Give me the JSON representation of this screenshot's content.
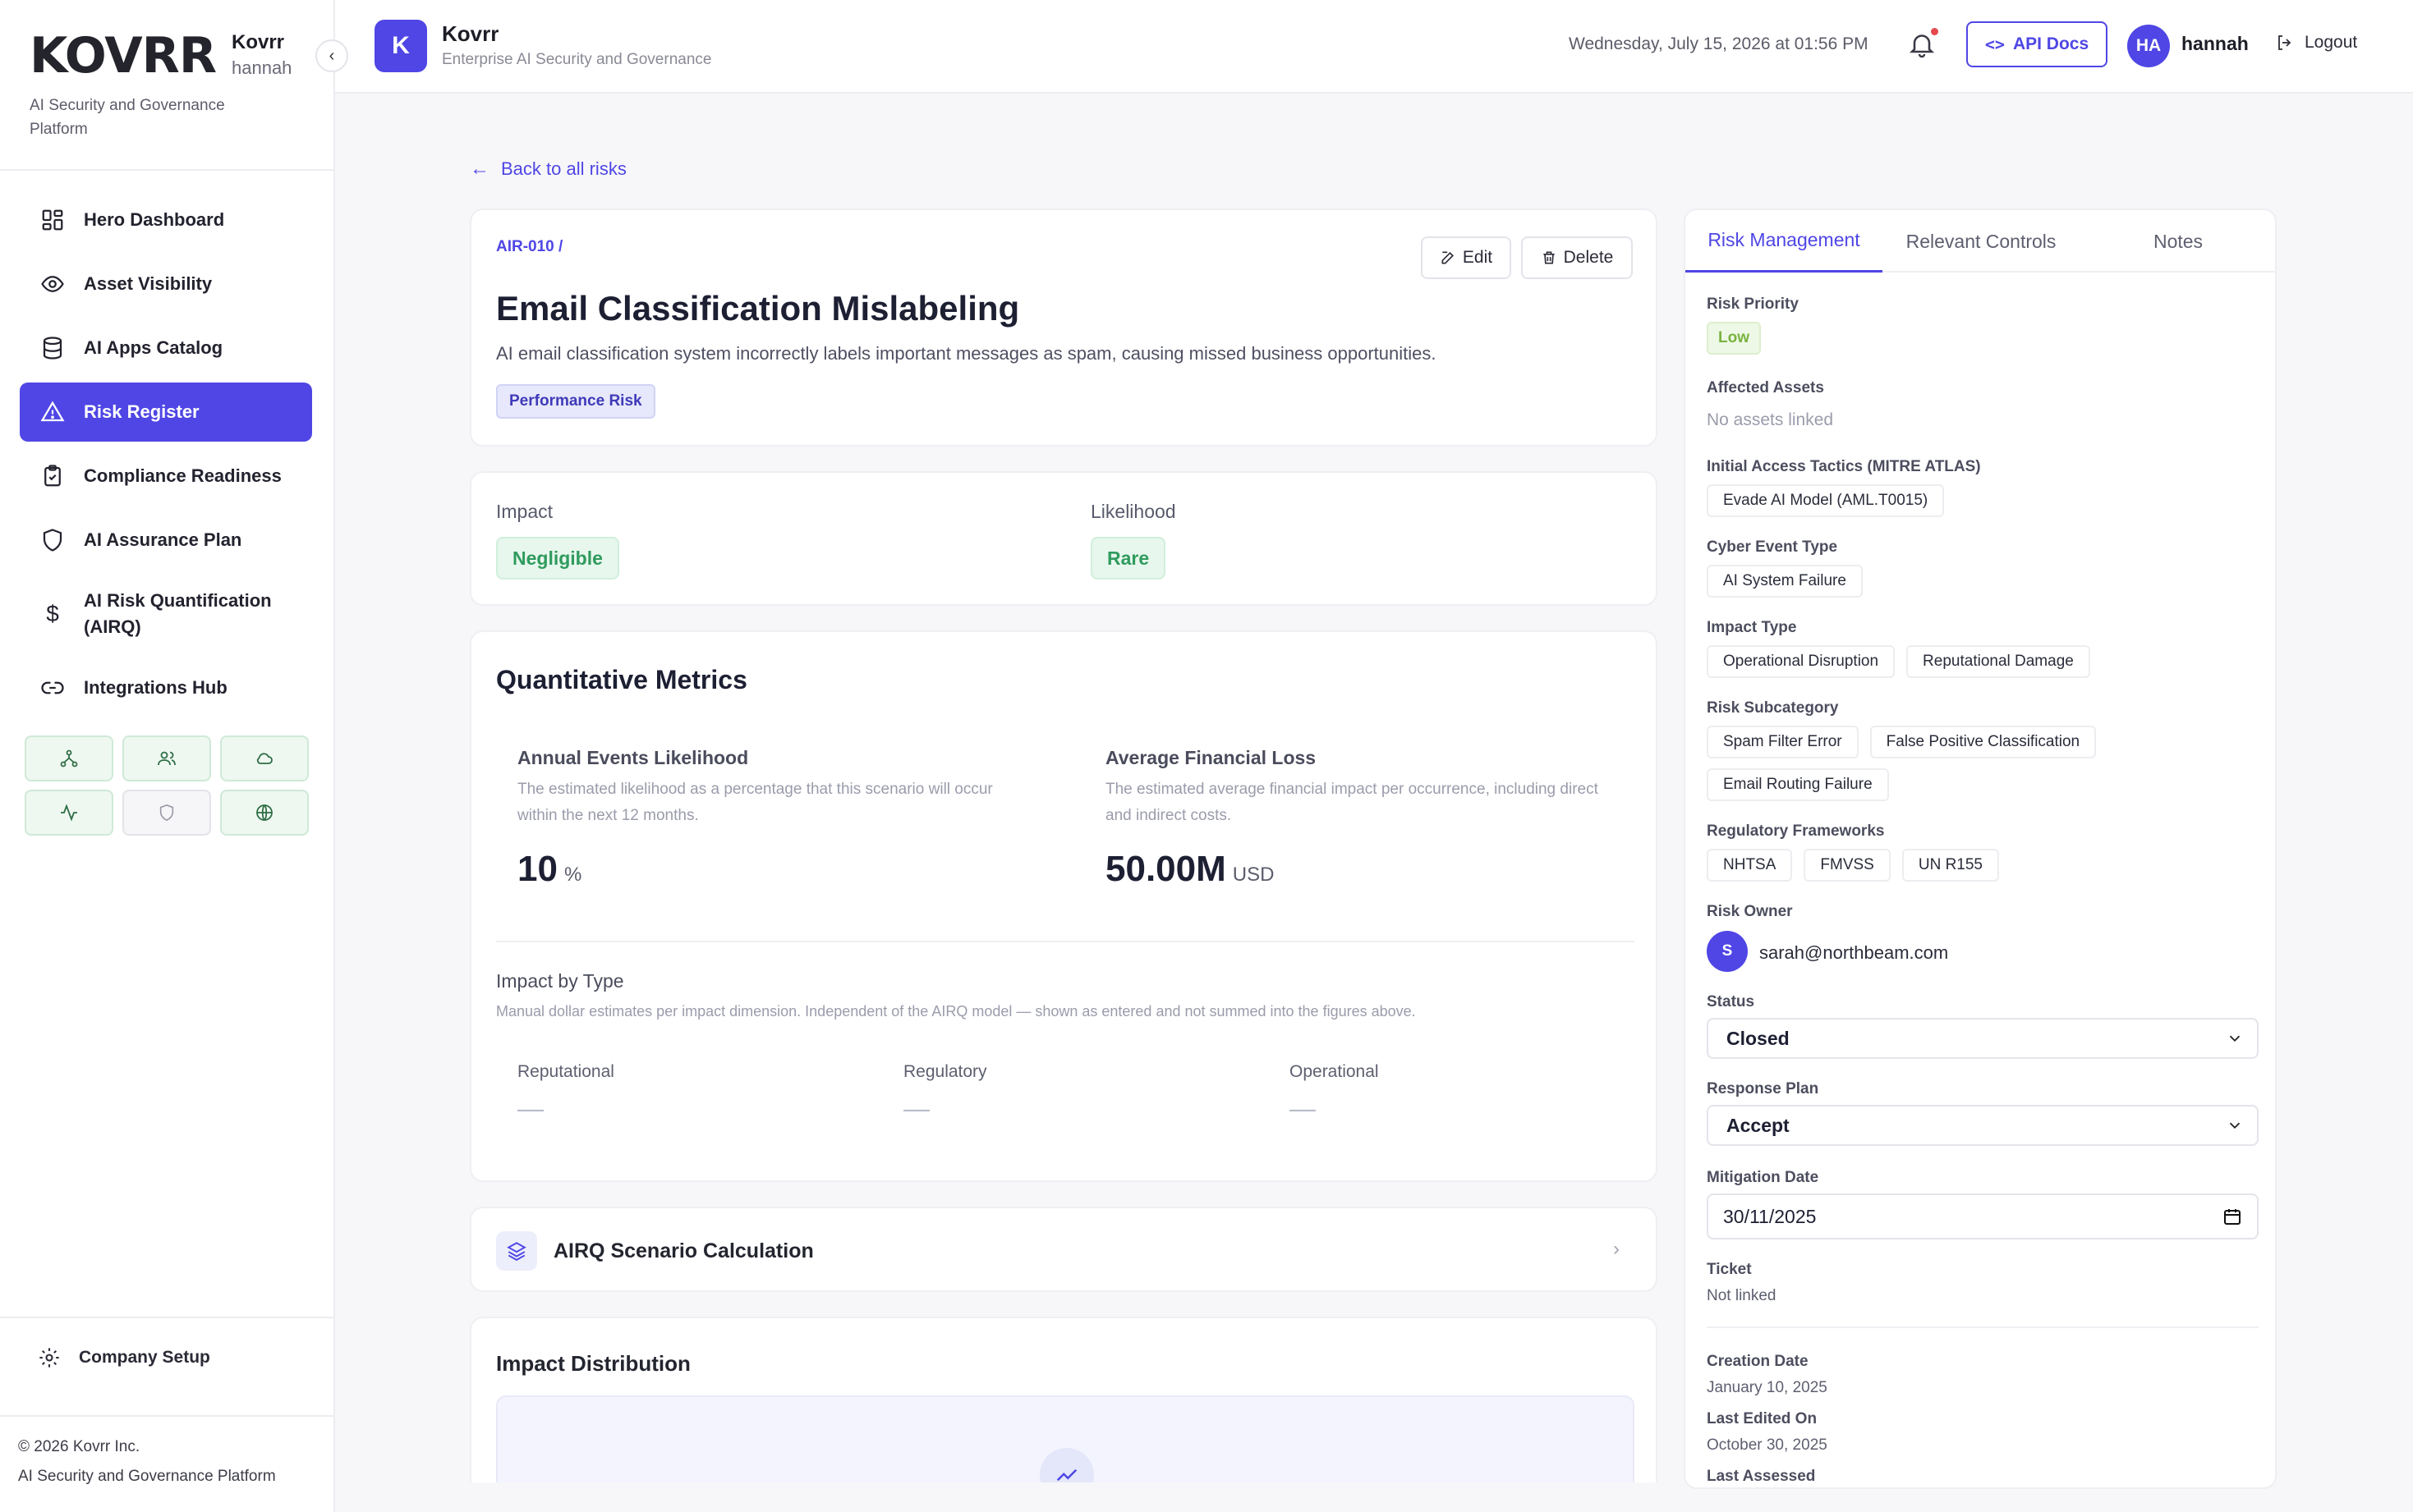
{
  "sidebar": {
    "logo_text": "KOVRR",
    "org_name": "Kovrr",
    "user": "hannah",
    "tagline": "AI Security and Governance Platform",
    "nav": [
      {
        "label": "Hero Dashboard",
        "icon": "dashboard-icon",
        "active": false
      },
      {
        "label": "Asset Visibility",
        "icon": "eye-icon",
        "active": false
      },
      {
        "label": "AI Apps Catalog",
        "icon": "database-icon",
        "active": false
      },
      {
        "label": "Risk Register",
        "icon": "warning-triangle-icon",
        "active": true
      },
      {
        "label": "Compliance Readiness",
        "icon": "clipboard-check-icon",
        "active": false
      },
      {
        "label": "AI Assurance Plan",
        "icon": "shield-icon",
        "active": false
      },
      {
        "label": "AI Risk Quantification (AIRQ)",
        "icon": "dollar-icon",
        "active": false
      },
      {
        "label": "Integrations Hub",
        "icon": "link-icon",
        "active": false
      }
    ],
    "quick_icons": [
      "network-icon",
      "users-icon",
      "cloud-icon",
      "activity-icon",
      "shield-outline-icon",
      "globe-icon"
    ],
    "company_setup": "Company Setup",
    "footer_copyright": "© 2026 Kovrr Inc.",
    "footer_tagline": "AI Security and Governance Platform"
  },
  "topbar": {
    "app_initial": "K",
    "app_title": "Kovrr",
    "app_subtitle": "Enterprise AI Security and Governance",
    "datetime": "Wednesday, July 15, 2026 at 01:56 PM",
    "api_docs": "API Docs",
    "user_initials": "HA",
    "user_name": "hannah",
    "logout": "Logout"
  },
  "back_link": "Back to all risks",
  "risk": {
    "id": "AIR-010 /",
    "title": "Email Classification Mislabeling",
    "description": "AI email classification system incorrectly labels important messages as spam, causing missed business opportunities.",
    "category": "Performance Risk",
    "edit_label": "Edit",
    "delete_label": "Delete",
    "impact_label": "Impact",
    "impact_value": "Negligible",
    "likelihood_label": "Likelihood",
    "likelihood_value": "Rare"
  },
  "metrics": {
    "title": "Quantitative Metrics",
    "annual": {
      "title": "Annual Events Likelihood",
      "desc": "The estimated likelihood as a percentage that this scenario will occur within the next 12 months.",
      "value": "10",
      "unit": "%"
    },
    "loss": {
      "title": "Average Financial Loss",
      "desc": "The estimated average financial impact per occurrence, including direct and indirect costs.",
      "value": "50.00M",
      "unit": "USD"
    },
    "impact_by_type": {
      "title": "Impact by Type",
      "desc": "Manual dollar estimates per impact dimension. Independent of the AIRQ model — shown as entered and not summed into the figures above.",
      "columns": [
        {
          "label": "Reputational",
          "value": "—"
        },
        {
          "label": "Regulatory",
          "value": "—"
        },
        {
          "label": "Operational",
          "value": "—"
        }
      ]
    }
  },
  "airq": {
    "label": "AIRQ Scenario Calculation"
  },
  "distribution": {
    "title": "Impact Distribution"
  },
  "panel": {
    "tabs": [
      "Risk Management",
      "Relevant Controls",
      "Notes"
    ],
    "risk_priority_label": "Risk Priority",
    "risk_priority": "Low",
    "affected_assets_label": "Affected Assets",
    "affected_assets": "No assets linked",
    "tactics_label": "Initial Access Tactics (MITRE ATLAS)",
    "tactics": [
      "Evade AI Model (AML.T0015)"
    ],
    "cyber_event_label": "Cyber Event Type",
    "cyber_events": [
      "AI System Failure"
    ],
    "impact_type_label": "Impact Type",
    "impact_types": [
      "Operational Disruption",
      "Reputational Damage"
    ],
    "subcategory_label": "Risk Subcategory",
    "subcategories": [
      "Spam Filter Error",
      "False Positive Classification",
      "Email Routing Failure"
    ],
    "frameworks_label": "Regulatory Frameworks",
    "frameworks": [
      "NHTSA",
      "FMVSS",
      "UN R155"
    ],
    "owner_label": "Risk Owner",
    "owner_initial": "S",
    "owner_email": "sarah@northbeam.com",
    "status_label": "Status",
    "status": "Closed",
    "response_label": "Response Plan",
    "response": "Accept",
    "mitigation_label": "Mitigation Date",
    "mitigation_date": "30/11/2025",
    "ticket_label": "Ticket",
    "ticket": "Not linked",
    "creation_label": "Creation Date",
    "creation_date": "January 10, 2025",
    "edited_label": "Last Edited On",
    "edited_date": "October 30, 2025",
    "assessed_label": "Last Assessed"
  },
  "colors": {
    "accent": "#4f46e5",
    "success": "#2f9b5d",
    "low_priority": "#79b33f"
  }
}
